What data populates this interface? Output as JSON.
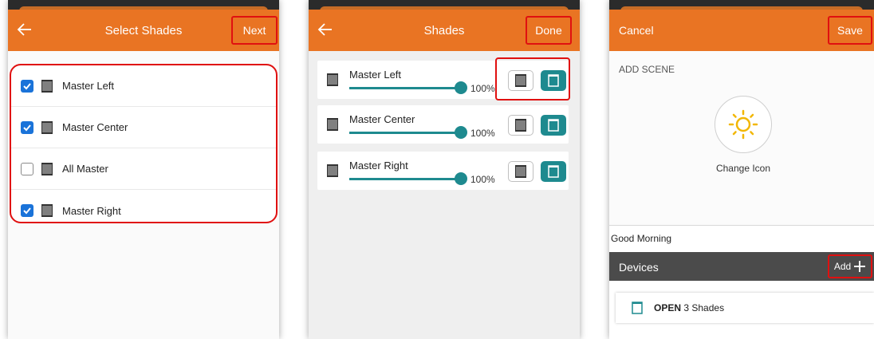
{
  "panels": {
    "select_shades": {
      "title": "Select Shades",
      "next_label": "Next",
      "items": [
        {
          "label": "Master Left",
          "checked": true
        },
        {
          "label": "Master Center",
          "checked": true
        },
        {
          "label": "All Master",
          "checked": false
        },
        {
          "label": "Master Right",
          "checked": true
        }
      ]
    },
    "shades": {
      "title": "Shades",
      "done_label": "Done",
      "rows": [
        {
          "label": "Master Left",
          "percent_text": "100%",
          "level": 1.0
        },
        {
          "label": "Master Center",
          "percent_text": "100%",
          "level": 1.0
        },
        {
          "label": "Master Right",
          "percent_text": "100%",
          "level": 1.0
        }
      ]
    },
    "add_scene": {
      "cancel_label": "Cancel",
      "save_label": "Save",
      "section_label": "ADD SCENE",
      "change_icon_label": "Change Icon",
      "scene_name": "Good Morning",
      "devices_label": "Devices",
      "add_label": "Add",
      "device": {
        "state": "OPEN",
        "count_text": "3 Shades"
      }
    }
  },
  "colors": {
    "header": "#e97423",
    "teal": "#1e8a8f",
    "checkbox": "#1a73d9",
    "highlight": "#e01010",
    "devices_bar": "#4b4b4b"
  },
  "icons": {
    "back": "arrow-left-icon",
    "shade": "shade-closed-icon",
    "shade_open": "shade-open-icon",
    "sun": "sun-icon",
    "plus": "plus-icon"
  }
}
